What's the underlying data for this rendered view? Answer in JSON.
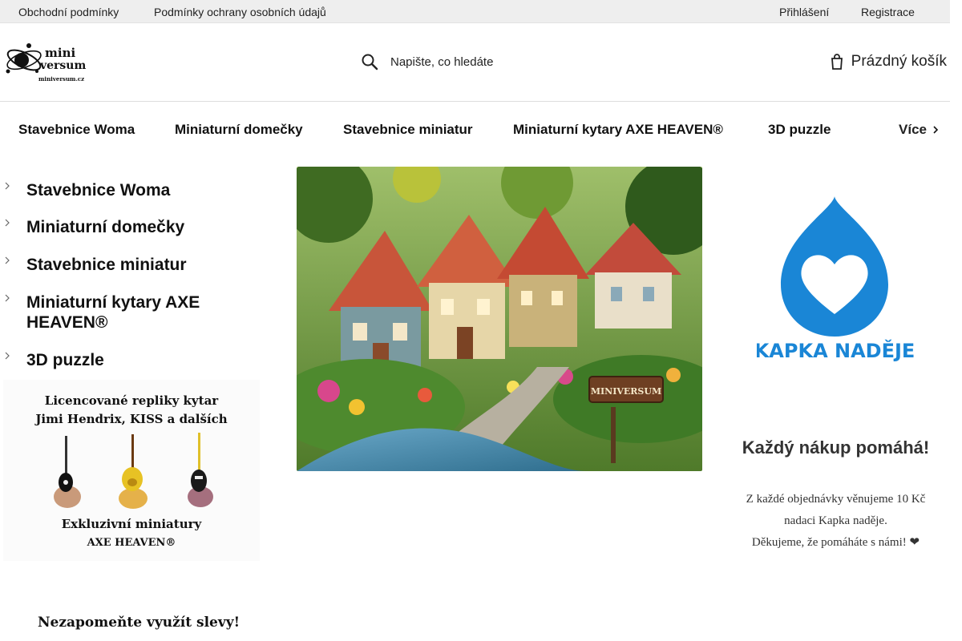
{
  "topbar": {
    "terms": "Obchodní podmínky",
    "privacy": "Podmínky ochrany osobních údajů",
    "login": "Přihlášení",
    "register": "Registrace"
  },
  "logo": {
    "line1": "mini",
    "line2": "versum",
    "domain": "miniversum.cz"
  },
  "search": {
    "placeholder": "Napište, co hledáte",
    "icon": "search-icon"
  },
  "cart": {
    "label": "Prázdný košík",
    "icon": "cart-icon"
  },
  "nav": {
    "items": [
      {
        "label": "Stavebnice Woma"
      },
      {
        "label": "Miniaturní domečky"
      },
      {
        "label": "Stavebnice miniatur"
      },
      {
        "label": "Miniaturní kytary AXE HEAVEN®"
      },
      {
        "label": "3D puzzle"
      }
    ],
    "more": "Více"
  },
  "sidebar": {
    "items": [
      {
        "label": "Stavebnice Woma"
      },
      {
        "label": "Miniaturní domečky"
      },
      {
        "label": "Stavebnice miniatur"
      },
      {
        "label": "Miniaturní kytary AXE HEAVEN®"
      },
      {
        "label": "3D puzzle"
      }
    ]
  },
  "guitar_banner": {
    "line1": "Licencované repliky kytar",
    "line2": "Jimi Hendrix, KISS a dalších",
    "line3": "Exkluzivní miniatury",
    "line4": "AXE HEAVEN®"
  },
  "hero": {
    "sign": "MINIVERSUM"
  },
  "charity": {
    "logo_text": "KAPKA NADĚJE",
    "title": "Každý nákup pomáhá!",
    "line1": "Z každé objednávky věnujeme 10 Kč",
    "line2": "nadaci Kapka naděje.",
    "line3": "Děkujeme, že pomáháte s námi! ❤"
  },
  "discount_banner": {
    "text": "Nezapomeňte využít slevy!"
  },
  "colors": {
    "accent_blue": "#1a86d6",
    "topbar_bg": "#eeeeee"
  }
}
